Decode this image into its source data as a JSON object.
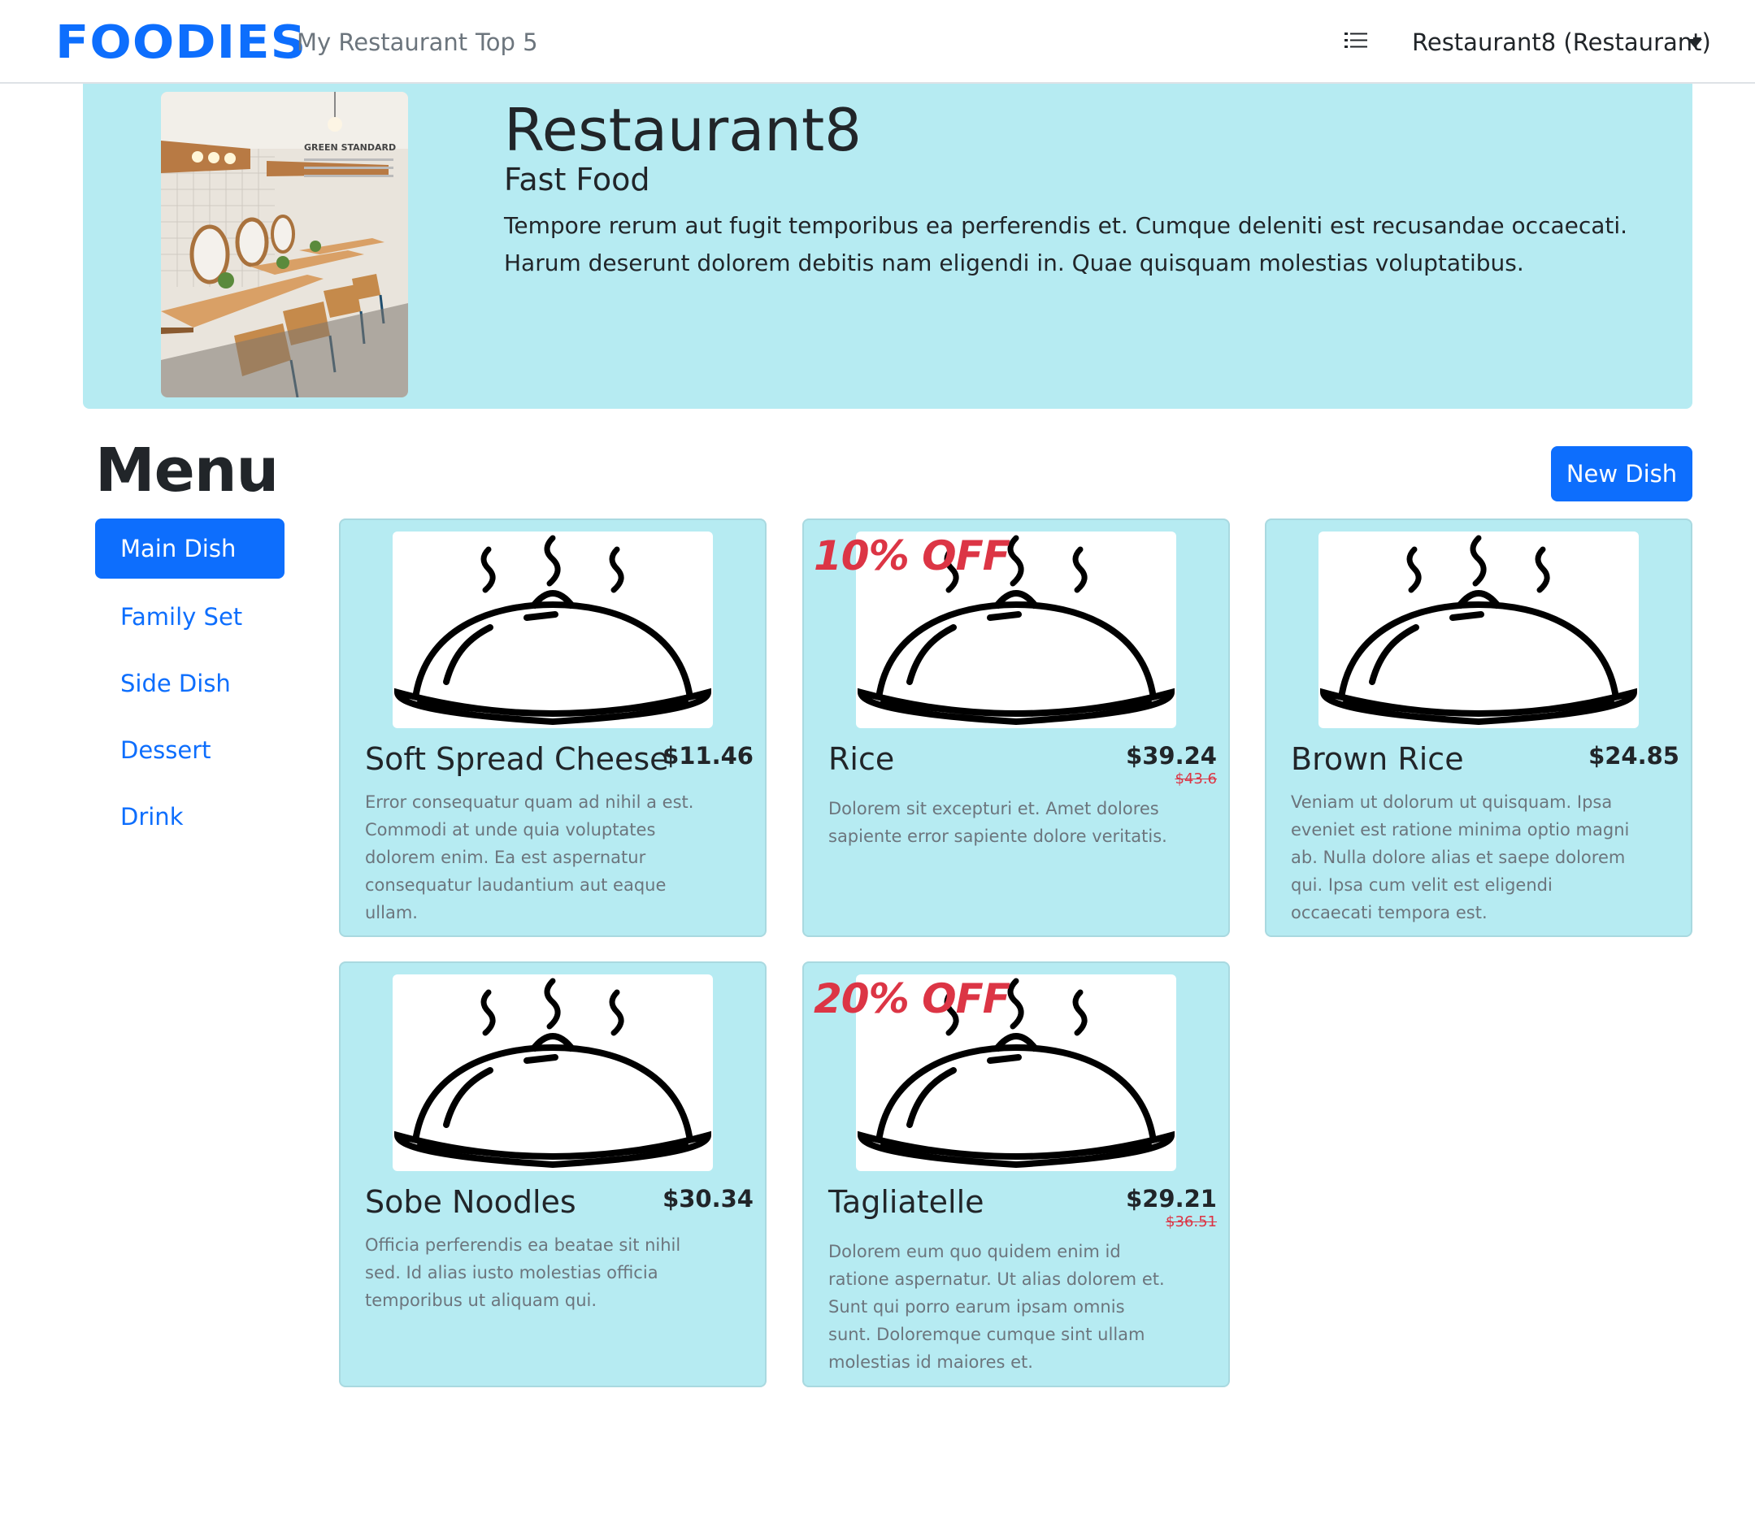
{
  "navbar": {
    "brand": "FOODIES",
    "links": [
      "My Restaurant",
      "Top 5"
    ],
    "user_menu": "Restaurant8 (Restaurant)"
  },
  "restaurant": {
    "name": "Restaurant8",
    "type": "Fast Food",
    "description": "Tempore rerum aut fugit temporibus ea perferendis et. Cumque deleniti est recusandae occaecati. Harum deserunt dolorem debitis nam eligendi in. Quae quisquam molestias voluptatibus.",
    "photo_sign": "GREEN STANDARD"
  },
  "menu": {
    "title": "Menu",
    "new_dish_label": "New Dish",
    "categories": [
      {
        "label": "Main Dish",
        "active": true
      },
      {
        "label": "Family Set",
        "active": false
      },
      {
        "label": "Side Dish",
        "active": false
      },
      {
        "label": "Dessert",
        "active": false
      },
      {
        "label": "Drink",
        "active": false
      }
    ],
    "dishes": [
      {
        "name": "Soft Spread Cheese",
        "price": "$11.46",
        "old_price": "",
        "discount": "",
        "description": "Error consequatur quam ad nihil a est. Commodi at unde quia voluptates dolorem enim. Ea est aspernatur consequatur laudantium aut eaque ullam."
      },
      {
        "name": "Rice",
        "price": "$39.24",
        "old_price": "$43.6",
        "discount": "10% OFF",
        "description": "Dolorem sit excepturi et. Amet dolores sapiente error sapiente dolore veritatis."
      },
      {
        "name": "Brown Rice",
        "price": "$24.85",
        "old_price": "",
        "discount": "",
        "description": "Veniam ut dolorum ut quisquam. Ipsa eveniet est ratione minima optio magni ab. Nulla dolore alias et saepe dolorem qui. Ipsa cum velit est eligendi occaecati tempora est."
      },
      {
        "name": "Sobe Noodles",
        "price": "$30.34",
        "old_price": "",
        "discount": "",
        "description": "Officia perferendis ea beatae sit nihil sed. Id alias iusto molestias officia temporibus ut aliquam qui."
      },
      {
        "name": "Tagliatelle",
        "price": "$29.21",
        "old_price": "$36.51",
        "discount": "20% OFF",
        "description": "Dolorem eum quo quidem enim id ratione aspernatur. Ut alias dolorem et. Sunt qui porro earum ipsam omnis sunt. Doloremque cumque sint ullam molestias id maiores et."
      }
    ]
  },
  "icons": {
    "list": "list-icon",
    "caret": "caret-down-icon",
    "dish_placeholder": "cloche-icon"
  },
  "colors": {
    "primary": "#0d6efd",
    "card_bg": "#b6ebf2",
    "discount": "#dc3545"
  }
}
